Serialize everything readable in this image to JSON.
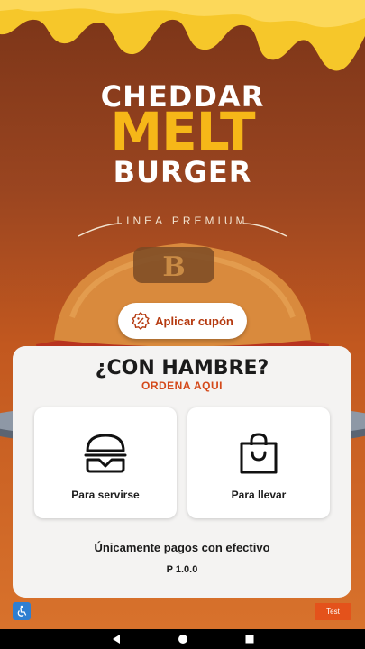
{
  "hero": {
    "line1": "CHEDDAR",
    "line2": "MELT",
    "line3": "BURGER",
    "tagline": "LINEA PREMIUM"
  },
  "coupon": {
    "label": "Aplicar cupón",
    "icon": "percent-badge-icon"
  },
  "card": {
    "headline": "¿CON HAMBRE?",
    "subheadline": "ORDENA AQUI",
    "options": [
      {
        "label": "Para servirse",
        "icon": "burger-icon"
      },
      {
        "label": "Para llevar",
        "icon": "shopping-bag-icon"
      }
    ],
    "payment_note": "Únicamente pagos con efectivo",
    "version": "P 1.0.0"
  },
  "footer": {
    "accessibility_icon": "wheelchair-icon",
    "test_label": "Test"
  },
  "navbar": {
    "back": "back-icon",
    "home": "home-icon",
    "recents": "recents-icon"
  },
  "colors": {
    "accent": "#d4491a",
    "cheese": "#f6b718",
    "card_bg": "#f4f3f2"
  }
}
